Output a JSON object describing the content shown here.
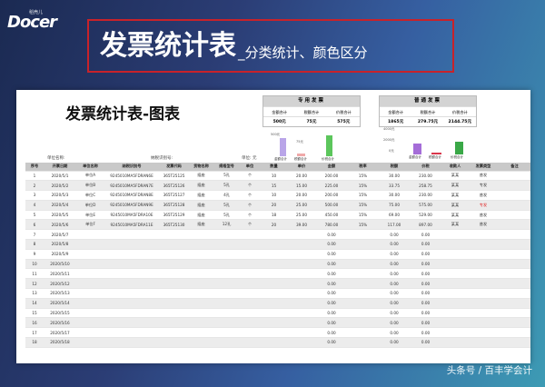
{
  "logo": {
    "sub": "稻壳儿",
    "main": "Docer"
  },
  "banner": {
    "title": "发票统计表",
    "subtitle": "_分类统计、颜色区分"
  },
  "sheet": {
    "title": "发票统计表-图表",
    "panel_special": {
      "header": "专用发票",
      "labels": [
        "金额合计",
        "税额合计",
        "价税合计"
      ],
      "values": [
        "500元",
        "75元",
        "575元"
      ],
      "chart": {
        "axis_top": "500元",
        "value_label": "75元",
        "cats": [
          "金额合计",
          "税额合计",
          "价税合计"
        ],
        "values": [
          500,
          75,
          575
        ]
      }
    },
    "panel_normal": {
      "header": "普通发票",
      "labels": [
        "金额合计",
        "税额合计",
        "价税合计"
      ],
      "values": [
        "1865元",
        "279.75元",
        "2144.75元"
      ],
      "chart": {
        "axis": [
          "4000元",
          "2000元",
          "0元"
        ],
        "cats": [
          "金额合计",
          "税额合计",
          "价税合计"
        ],
        "values": [
          1865,
          279.75,
          2144.75
        ]
      }
    },
    "meta": {
      "unit_name": "单位名称:",
      "tax_no": "纳税识别号:",
      "unit": "单位: 元"
    },
    "table": {
      "headers": [
        "序号",
        "开票日期",
        "单位名称",
        "纳税识别号",
        "发票代码",
        "货物名称",
        "规格型号",
        "单位",
        "数量",
        "单价",
        "金额",
        "税率",
        "税额",
        "价税",
        "收款人",
        "发票类型",
        "备注"
      ],
      "rows": [
        [
          "1",
          "2020/5/1",
          "单位A",
          "9245010MA5FDRAN6E",
          "365T25125",
          "插座",
          "5孔",
          "个",
          "10",
          "20.00",
          "200.00",
          "15%",
          "30.00",
          "230.00",
          "某某",
          "普发",
          ""
        ],
        [
          "2",
          "2020/5/2",
          "单位B",
          "9245010MA5FDRAN7E",
          "365T25126",
          "插座",
          "5孔",
          "个",
          "15",
          "15.00",
          "225.00",
          "15%",
          "33.75",
          "258.75",
          "某某",
          "专发",
          ""
        ],
        [
          "3",
          "2020/5/3",
          "单位C",
          "9245010MA5FDRAN8E",
          "365T25127",
          "插座",
          "4孔",
          "个",
          "10",
          "20.00",
          "200.00",
          "15%",
          "30.00",
          "230.00",
          "某某",
          "普发",
          ""
        ],
        [
          "4",
          "2020/5/4",
          "单位D",
          "9245010MA5FDRAN9E",
          "365T25128",
          "插座",
          "5孔",
          "个",
          "20",
          "25.00",
          "500.00",
          "15%",
          "75.00",
          "575.00",
          "某某",
          "专发",
          ""
        ],
        [
          "5",
          "2020/5/5",
          "单位E",
          "9245010MA5FDRA10E",
          "365T25129",
          "插座",
          "5孔",
          "个",
          "18",
          "25.00",
          "450.00",
          "15%",
          "69.00",
          "529.00",
          "某某",
          "普发",
          ""
        ],
        [
          "6",
          "2020/5/6",
          "单位F",
          "9245010MA5FDRA11E",
          "365T25130",
          "插座",
          "12孔",
          "个",
          "20",
          "39.00",
          "780.00",
          "15%",
          "117.00",
          "897.00",
          "某某",
          "普发",
          ""
        ],
        [
          "7",
          "2020/5/7",
          "",
          "",
          "",
          "",
          "",
          "",
          "",
          "",
          "0.00",
          "",
          "0.00",
          "0.00",
          "",
          "",
          ""
        ],
        [
          "8",
          "2020/5/8",
          "",
          "",
          "",
          "",
          "",
          "",
          "",
          "",
          "0.00",
          "",
          "0.00",
          "0.00",
          "",
          "",
          ""
        ],
        [
          "9",
          "2020/5/9",
          "",
          "",
          "",
          "",
          "",
          "",
          "",
          "",
          "0.00",
          "",
          "0.00",
          "0.00",
          "",
          "",
          ""
        ],
        [
          "10",
          "2020/5/10",
          "",
          "",
          "",
          "",
          "",
          "",
          "",
          "",
          "0.00",
          "",
          "0.00",
          "0.00",
          "",
          "",
          ""
        ],
        [
          "11",
          "2020/5/11",
          "",
          "",
          "",
          "",
          "",
          "",
          "",
          "",
          "0.00",
          "",
          "0.00",
          "0.00",
          "",
          "",
          ""
        ],
        [
          "12",
          "2020/5/12",
          "",
          "",
          "",
          "",
          "",
          "",
          "",
          "",
          "0.00",
          "",
          "0.00",
          "0.00",
          "",
          "",
          ""
        ],
        [
          "13",
          "2020/5/13",
          "",
          "",
          "",
          "",
          "",
          "",
          "",
          "",
          "0.00",
          "",
          "0.00",
          "0.00",
          "",
          "",
          ""
        ],
        [
          "14",
          "2020/5/14",
          "",
          "",
          "",
          "",
          "",
          "",
          "",
          "",
          "0.00",
          "",
          "0.00",
          "0.00",
          "",
          "",
          ""
        ],
        [
          "15",
          "2020/5/15",
          "",
          "",
          "",
          "",
          "",
          "",
          "",
          "",
          "0.00",
          "",
          "0.00",
          "0.00",
          "",
          "",
          ""
        ],
        [
          "16",
          "2020/5/16",
          "",
          "",
          "",
          "",
          "",
          "",
          "",
          "",
          "0.00",
          "",
          "0.00",
          "0.00",
          "",
          "",
          ""
        ],
        [
          "17",
          "2020/5/17",
          "",
          "",
          "",
          "",
          "",
          "",
          "",
          "",
          "0.00",
          "",
          "0.00",
          "0.00",
          "",
          "",
          ""
        ],
        [
          "18",
          "2020/5/18",
          "",
          "",
          "",
          "",
          "",
          "",
          "",
          "",
          "0.00",
          "",
          "0.00",
          "0.00",
          "",
          "",
          ""
        ]
      ],
      "highlight_color": "#e02020"
    }
  },
  "watermark": "头条号 / 百丰学会计"
}
